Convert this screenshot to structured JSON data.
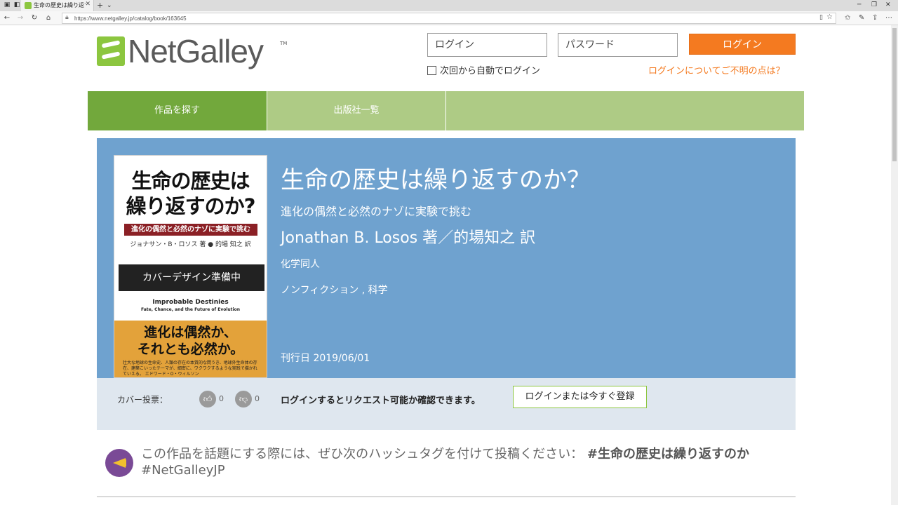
{
  "browser": {
    "tab_title": "生命の歴史は繰り返すのか",
    "url": "https://www.netgalley.jp/catalog/book/163645"
  },
  "header": {
    "logo_text": "NetGalley",
    "logo_tm": "TM",
    "login_placeholder": "ログイン",
    "password_placeholder": "パスワード",
    "login_button": "ログイン",
    "remember_label": "次回から自動でログイン",
    "help_link": "ログインについてご不明の点は？"
  },
  "nav": {
    "items": [
      {
        "label": "作品を探す",
        "active": true
      },
      {
        "label": "出版社一覧",
        "active": false
      }
    ]
  },
  "book": {
    "title": "生命の歴史は繰り返すのか？",
    "subtitle": "進化の偶然と必然のナゾに実験で挑む",
    "author": "Jonathan B. Losos 著／的場知之 訳",
    "publisher": "化学同人",
    "categories": "ノンフィクション , 科学",
    "release_label": "刊行日",
    "release_date": "2019/06/01",
    "cover": {
      "title_line1": "生命の歴史は",
      "title_line2": "繰り返すのか?",
      "band": "進化の偶然と必然のナゾに実験で挑む",
      "authors": "ジョナサン・B・ロソス 著 ● 的場 知之 訳",
      "placeholder": "カバーデザイン準備中",
      "english_title": "Improbable Destinies",
      "english_subtitle": "Fate, Chance, and the Future of Evolution",
      "catch_line1": "進化は偶然か、",
      "catch_line2": "それとも必然か。",
      "blurb": "壮大な地球の生命史、人類の存在の本質的な問うき、地球外生命体の存在、建築こいったテーマが、細密に、ワクワクするような実践で描かれていえる。 エドワード・O・ウィルソン"
    }
  },
  "vote": {
    "label": "カバー投票：",
    "up_count": "0",
    "down_count": "0",
    "request_message": "ログインするとリクエスト可能か確認できます。",
    "request_button": "ログインまたは今すぐ登録"
  },
  "hashtag": {
    "text": "この作品を話題にする際には、ぜひ次のハッシュタグを付けて投稿ください：",
    "tag1": "#生命の歴史は繰り返すのか",
    "tag2": "#NetGalleyJP"
  }
}
